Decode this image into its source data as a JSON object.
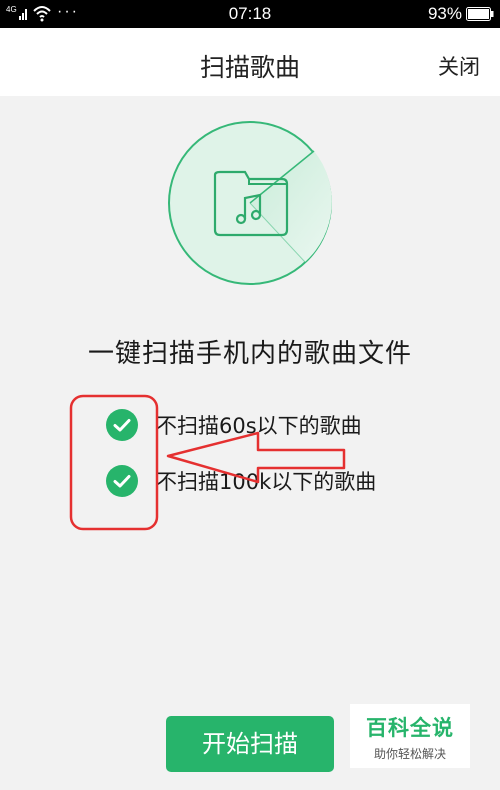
{
  "status_bar": {
    "network": "4G",
    "dots": "···",
    "time": "07:18",
    "battery": "93%"
  },
  "header": {
    "title": "扫描歌曲",
    "close_label": "关闭"
  },
  "illustration": {
    "icon": "music-folder-icon"
  },
  "headline": "一键扫描手机内的歌曲文件",
  "options": [
    {
      "label": "不扫描60s以下的歌曲",
      "checked": true
    },
    {
      "label": "不扫描100k以下的歌曲",
      "checked": true
    }
  ],
  "start_button": "开始扫描",
  "watermark": {
    "main": "百科全说",
    "sub": "助你轻松解决"
  },
  "colors": {
    "accent": "#27b46b",
    "annotation": "#e53030"
  }
}
